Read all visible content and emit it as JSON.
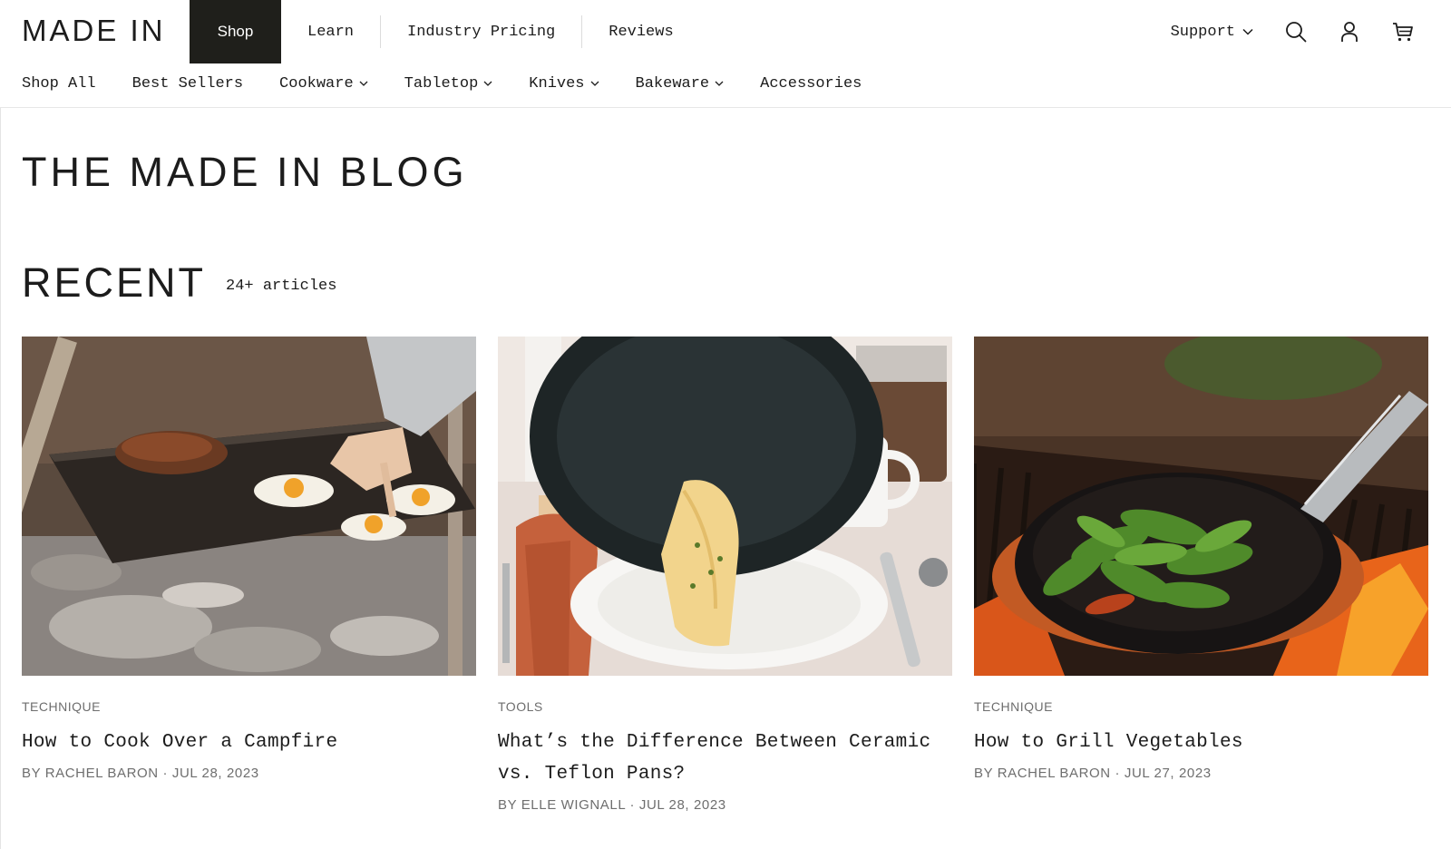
{
  "brand": {
    "logo_text": "MADE IN"
  },
  "primary_nav": [
    {
      "label": "Shop",
      "active": true
    },
    {
      "label": "Learn",
      "active": false
    },
    {
      "label": "Industry Pricing",
      "active": false
    },
    {
      "label": "Reviews",
      "active": false
    }
  ],
  "utility_nav": {
    "support_label": "Support",
    "icons": [
      "search-icon",
      "account-icon",
      "cart-icon"
    ]
  },
  "secondary_nav": [
    {
      "label": "Shop All",
      "has_dropdown": false
    },
    {
      "label": "Best Sellers",
      "has_dropdown": false
    },
    {
      "label": "Cookware",
      "has_dropdown": true
    },
    {
      "label": "Tabletop",
      "has_dropdown": true
    },
    {
      "label": "Knives",
      "has_dropdown": true
    },
    {
      "label": "Bakeware",
      "has_dropdown": true
    },
    {
      "label": "Accessories",
      "has_dropdown": false
    }
  ],
  "page": {
    "title": "THE MADE IN BLOG",
    "section_title": "RECENT",
    "section_count": "24+ articles"
  },
  "articles": [
    {
      "category": "TECHNIQUE",
      "title": "How to Cook Over a Campfire",
      "byline": "BY RACHEL BARON · JUL 28, 2023"
    },
    {
      "category": "TOOLS",
      "title": "What’s the Difference Between Ceramic vs. Teflon Pans?",
      "byline": "BY ELLE WIGNALL · JUL 28, 2023"
    },
    {
      "category": "TECHNIQUE",
      "title": "How to Grill Vegetables",
      "byline": "BY RACHEL BARON · JUL 27, 2023"
    }
  ],
  "colors": {
    "text": "#1c1c1c",
    "muted": "#6e6e6e",
    "active_nav_bg": "#1f1f1b",
    "divider": "#e7e7e7"
  }
}
